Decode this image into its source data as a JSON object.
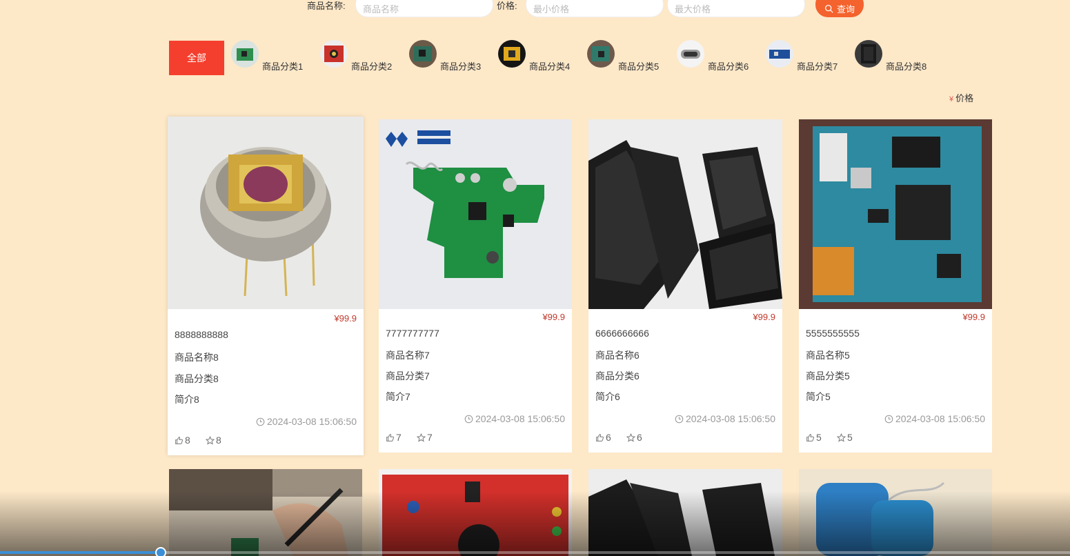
{
  "search": {
    "name_label": "商品名称:",
    "name_placeholder": "商品名称",
    "price_label": "价格:",
    "min_placeholder": "最小价格",
    "max_placeholder": "最大价格",
    "button_label": "查询"
  },
  "categories": {
    "all_label": "全部",
    "items": [
      {
        "label": "商品分类1"
      },
      {
        "label": "商品分类2"
      },
      {
        "label": "商品分类3"
      },
      {
        "label": "商品分类4"
      },
      {
        "label": "商品分类5"
      },
      {
        "label": "商品分类6"
      },
      {
        "label": "商品分类7"
      },
      {
        "label": "商品分类8"
      }
    ]
  },
  "sort": {
    "currency_symbol": "¥",
    "price_label": "价格"
  },
  "products": [
    {
      "price": "¥99.9",
      "code": "8888888888",
      "name": "商品名称8",
      "category": "商品分类8",
      "intro": "简介8",
      "time": "2024-03-08 15:06:50",
      "likes": "8",
      "favorites": "8"
    },
    {
      "price": "¥99.9",
      "code": "7777777777",
      "name": "商品名称7",
      "category": "商品分类7",
      "intro": "简介7",
      "time": "2024-03-08 15:06:50",
      "likes": "7",
      "favorites": "7"
    },
    {
      "price": "¥99.9",
      "code": "6666666666",
      "name": "商品名称6",
      "category": "商品分类6",
      "intro": "简介6",
      "time": "2024-03-08 15:06:50",
      "likes": "6",
      "favorites": "6"
    },
    {
      "price": "¥99.9",
      "code": "5555555555",
      "name": "商品名称5",
      "category": "商品分类5",
      "intro": "简介5",
      "time": "2024-03-08 15:06:50",
      "likes": "5",
      "favorites": "5"
    }
  ],
  "video_progress": 0.15,
  "colors": {
    "accent": "#f43f2e",
    "button": "#f4622d",
    "background": "#fde8c8",
    "price": "#c0392b"
  }
}
